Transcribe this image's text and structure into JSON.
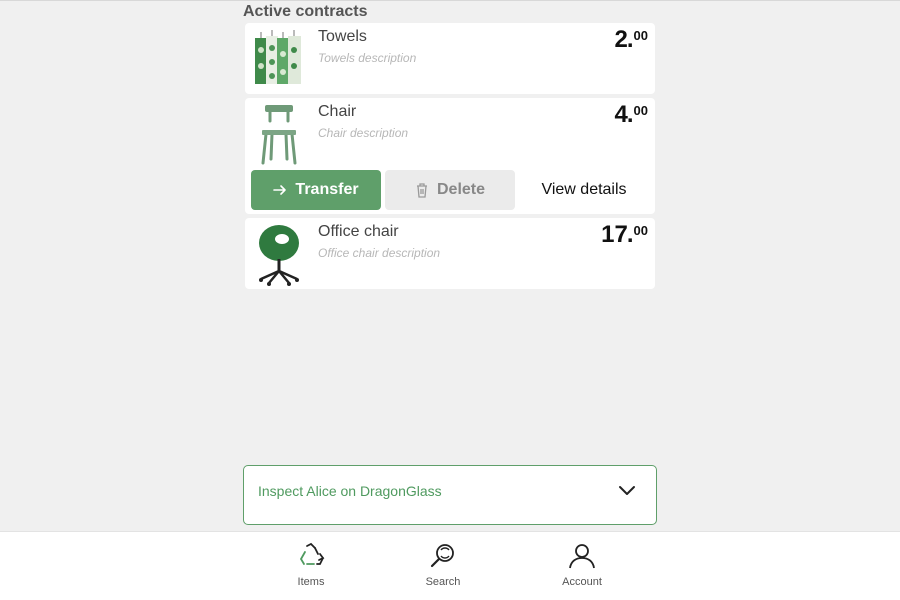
{
  "header": {
    "title": "Active contracts"
  },
  "contracts": [
    {
      "name": "Towels",
      "description": "Towels description",
      "price_int": "2",
      "price_cents": "00"
    },
    {
      "name": "Chair",
      "description": "Chair description",
      "price_int": "4",
      "price_cents": "00"
    },
    {
      "name": "Office chair",
      "description": "Office chair description",
      "price_int": "17",
      "price_cents": "00"
    }
  ],
  "actions": {
    "transfer": "Transfer",
    "delete": "Delete",
    "view_details": "View details"
  },
  "inspect": {
    "label": "Inspect Alice on DragonGlass"
  },
  "nav": {
    "items": [
      {
        "label": "Items",
        "icon": "recycle-icon"
      },
      {
        "label": "Search",
        "icon": "search-icon"
      },
      {
        "label": "Account",
        "icon": "user-icon"
      }
    ]
  },
  "colors": {
    "accent": "#5f9f6a",
    "background": "#f0f0f0",
    "delete_bg": "#ebebeb"
  }
}
